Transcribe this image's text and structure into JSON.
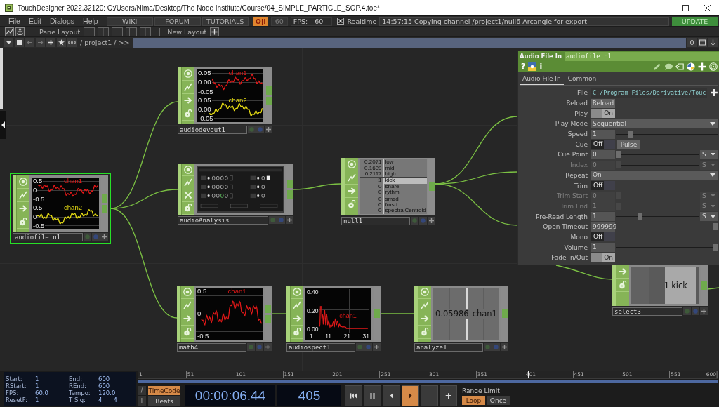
{
  "title_bar": {
    "title": "TouchDesigner 2022.32120: C:/Users/Nima/Desktop/The Node Institute/Course/04_SIMPLE_PARTICLE_SOP.4.toe*"
  },
  "menu_bar": {
    "menus": [
      "File",
      "Edit",
      "Dialogs",
      "Help"
    ],
    "links": [
      "WIKI",
      "FORUM",
      "TUTORIALS"
    ],
    "cook_toggle": {
      "label": "O|I",
      "on": true
    },
    "frame_rate_field": {
      "value": "60",
      "disabled": true
    },
    "fps": {
      "label": "FPS:",
      "value": "60"
    },
    "realtime": {
      "label": "Realtime",
      "checked": true
    },
    "status_message": "14:57:15 Copying channel /project1/null6 Arcangle for export.",
    "update_button": "UPDATE"
  },
  "toolbar": {
    "pane_layout_label": "Pane Layout",
    "new_layout_label": "New Layout"
  },
  "path_bar": {
    "back_disabled": true,
    "forward_disabled": true,
    "path": "/ project1 / >>",
    "counter": "0"
  },
  "nodes": [
    {
      "name": "audiofilein1",
      "kind": "waveform",
      "selected": true,
      "channels": [
        {
          "name": "chan1",
          "color": "#e01818",
          "ticks": [
            "0.5",
            "0",
            "-0.5"
          ]
        },
        {
          "name": "chan2",
          "color": "#e6dc14",
          "ticks": [
            "0.5",
            "0",
            "-0.5"
          ]
        }
      ]
    },
    {
      "name": "audiodevout1",
      "kind": "waveform",
      "selected": false,
      "channels": [
        {
          "name": "chan1",
          "color": "#e01818",
          "ticks": [
            "0.05",
            "0.00",
            "-0.05"
          ]
        },
        {
          "name": "chan2",
          "color": "#e6dc14",
          "ticks": [
            "0.05",
            "0.00",
            "-0.05"
          ]
        }
      ]
    },
    {
      "name": "audioAnalysis",
      "kind": "panel",
      "selected": false
    },
    {
      "name": "null1",
      "kind": "channel_list",
      "selected": false,
      "groups": [
        {
          "channels": [
            {
              "value": "0.2071",
              "name": "low",
              "highlighted": false
            },
            {
              "value": "0.1639",
              "name": "mid",
              "highlighted": false
            },
            {
              "value": "0.2117",
              "name": "high",
              "highlighted": false
            }
          ]
        },
        {
          "channels": [
            {
              "value": "1",
              "name": "kick",
              "highlighted": true
            },
            {
              "value": "0",
              "name": "snare",
              "highlighted": false
            },
            {
              "value": "0",
              "name": "rythm",
              "highlighted": false
            }
          ]
        },
        {
          "channels": [
            {
              "value": "0",
              "name": "smsd",
              "highlighted": false
            },
            {
              "value": "0",
              "name": "fmsd",
              "highlighted": false
            },
            {
              "value": "0",
              "name": "spectralCentroid",
              "highlighted": false
            }
          ]
        }
      ]
    },
    {
      "name": "math4",
      "kind": "waveform",
      "selected": false,
      "channels": [
        {
          "name": "chan1",
          "color": "#e01818",
          "ticks": [
            "0.5",
            "0",
            "-0.5"
          ]
        }
      ]
    },
    {
      "name": "audiospect1",
      "kind": "spectrum",
      "selected": false,
      "channels": [
        {
          "name": "chan1",
          "color": "#e01818"
        }
      ],
      "y_ticks": [
        "0.40",
        "0.20",
        "0.00"
      ],
      "x_ticks": [
        "1",
        "11",
        "21",
        "31"
      ]
    },
    {
      "name": "analyze1",
      "kind": "value",
      "selected": false,
      "value": "0.05986",
      "channel": "chan1",
      "highlighted": false
    },
    {
      "name": "select3",
      "kind": "value",
      "selected": false,
      "value": "1",
      "channel": "kick",
      "highlighted": true
    }
  ],
  "parameters": {
    "type_label": "Audio File In",
    "node_name": "audiofilein1",
    "glyphs": {
      "help": "?",
      "info": "i"
    },
    "tabs": [
      {
        "label": "Audio File In",
        "selected": true
      },
      {
        "label": "Common",
        "selected": false
      }
    ],
    "params": [
      {
        "label": "File",
        "kind": "file",
        "value": "C:/Program Files/Derivative/Touc",
        "disabled": false
      },
      {
        "label": "Reload",
        "kind": "pulse",
        "button": "Reload",
        "disabled": false
      },
      {
        "label": "Play",
        "kind": "toggle",
        "on": true,
        "value": "On",
        "disabled": false
      },
      {
        "label": "Play Mode",
        "kind": "menu",
        "value": "Sequential",
        "disabled": false
      },
      {
        "label": "Speed",
        "kind": "slider",
        "value": "1",
        "level": 0.12,
        "disabled": false
      },
      {
        "label": "Cue",
        "kind": "toggle_pulse",
        "on": false,
        "value": "Off",
        "button": "Pulse",
        "disabled": false
      },
      {
        "label": "Cue Point",
        "kind": "slider",
        "value": "0",
        "level": 0,
        "unit": "S",
        "disabled": false
      },
      {
        "label": "Index",
        "kind": "slider",
        "value": "0",
        "level": 0,
        "unit": "S",
        "disabled": true
      },
      {
        "label": "Repeat",
        "kind": "menu",
        "value": "On",
        "disabled": false
      },
      {
        "label": "Trim",
        "kind": "toggle",
        "on": false,
        "value": "Off",
        "disabled": false
      },
      {
        "label": "Trim Start",
        "kind": "slider",
        "value": "0",
        "level": 0,
        "unit": "S",
        "disabled": true
      },
      {
        "label": "Trim End",
        "kind": "slider",
        "value": "1",
        "level": 0,
        "unit": "S",
        "disabled": true
      },
      {
        "label": "Pre-Read Length",
        "kind": "slider",
        "value": "1",
        "level": 0.27,
        "unit": "S",
        "disabled": false
      },
      {
        "label": "Open Timeout",
        "kind": "slider",
        "value": "999999",
        "level": 1,
        "disabled": false
      },
      {
        "label": "Mono",
        "kind": "toggle",
        "on": false,
        "value": "Off",
        "disabled": false
      },
      {
        "label": "Volume",
        "kind": "slider",
        "value": "1",
        "level": 1,
        "disabled": false
      },
      {
        "label": "Fade In/Out",
        "kind": "toggle",
        "on": true,
        "value": "On",
        "disabled": false
      }
    ]
  },
  "timeline": {
    "info": [
      {
        "label": "Start:",
        "values": [
          "1"
        ]
      },
      {
        "label": "End:",
        "values": [
          "600"
        ]
      },
      {
        "label": "RStart:",
        "values": [
          "1"
        ]
      },
      {
        "label": "REnd:",
        "values": [
          "600"
        ]
      },
      {
        "label": "FPS:",
        "values": [
          "60.0"
        ]
      },
      {
        "label": "Tempo:",
        "values": [
          "120.0"
        ]
      },
      {
        "label": "ResetF:",
        "values": [
          "1"
        ]
      },
      {
        "label": "T Sig:",
        "values": [
          "4",
          "4"
        ]
      }
    ],
    "ruler_labels": [
      "1",
      "51",
      "101",
      "151",
      "201",
      "251",
      "301",
      "351",
      "401",
      "451",
      "501",
      "551",
      "600"
    ],
    "level": 0.675,
    "edit_buttons": [
      "/",
      "I"
    ],
    "modes": [
      {
        "label": "TimeCode",
        "selected": true
      },
      {
        "label": "Beats",
        "selected": false
      }
    ],
    "timecode": "00:00:06.44",
    "frame": "405",
    "transport": [
      {
        "kind": "to_start",
        "selected": false
      },
      {
        "kind": "pause",
        "selected": false
      },
      {
        "kind": "reverse",
        "selected": false
      },
      {
        "kind": "play",
        "selected": true
      },
      {
        "kind": "step",
        "label": "-",
        "selected": false
      },
      {
        "kind": "step",
        "label": "+",
        "selected": false
      }
    ],
    "range_limit": {
      "label": "Range Limit",
      "options": [
        {
          "label": "Loop",
          "selected": true
        },
        {
          "label": "Once",
          "selected": false
        }
      ]
    }
  }
}
